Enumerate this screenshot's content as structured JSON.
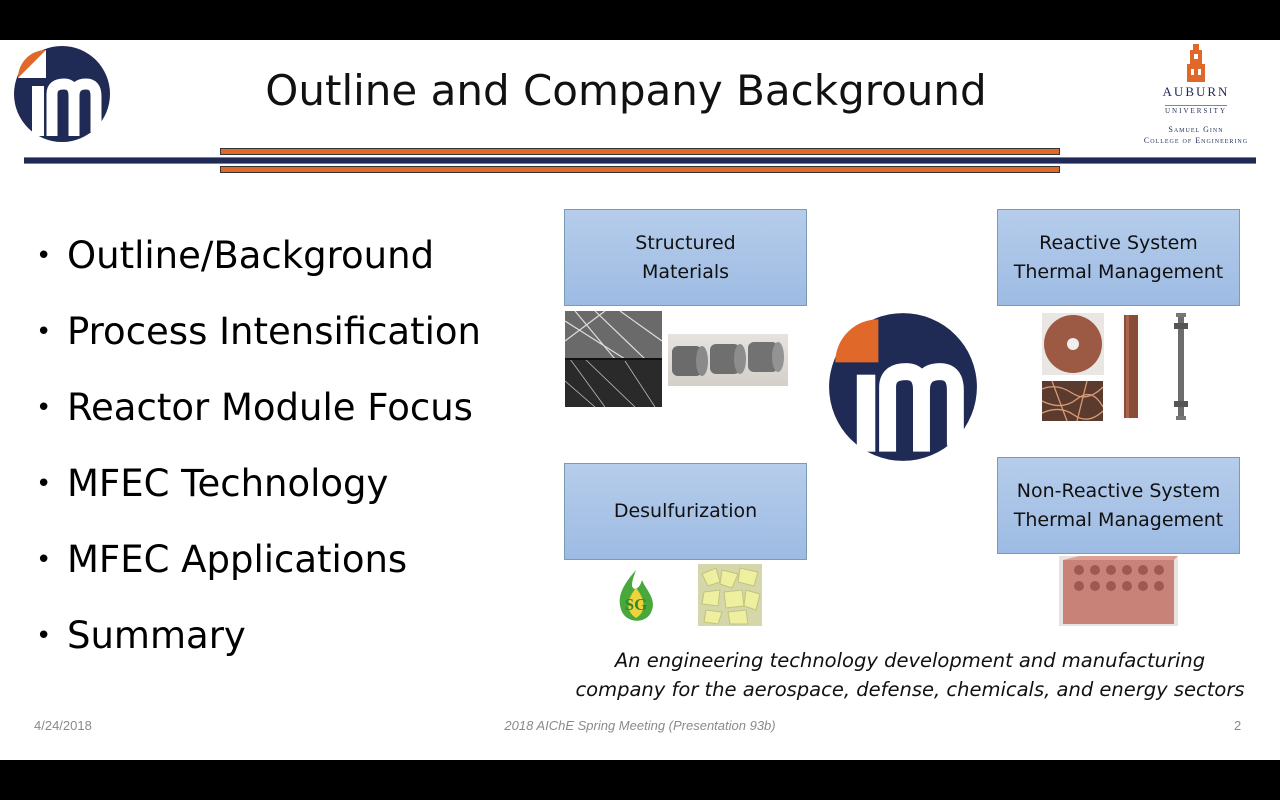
{
  "slide": {
    "title": "Outline and Company Background",
    "bullets": [
      "Outline/Background",
      "Process Intensification",
      "Reactor Module Focus",
      "MFEC Technology",
      "MFEC Applications",
      "Summary"
    ],
    "boxes": {
      "structured_materials": [
        "Structured",
        "Materials"
      ],
      "reactive_system": [
        "Reactive System",
        "Thermal Management"
      ],
      "desulfurization": "Desulfurization",
      "non_reactive_system": [
        "Non-Reactive System",
        "Thermal Management"
      ]
    },
    "tagline": [
      "An engineering technology development and manufacturing",
      "company for the aerospace, defense, chemicals, and energy sectors"
    ],
    "sg_logo_text": "SG"
  },
  "auburn_logo": {
    "name": "AUBURN",
    "university": "UNIVERSITY",
    "college_line1": "Samuel Ginn",
    "college_line2": "College of Engineering"
  },
  "footer": {
    "date": "4/24/2018",
    "meeting": "2018 AIChE Spring Meeting (Presentation 93b)",
    "page": "2"
  },
  "colors": {
    "navy": "#1f2a55",
    "orange": "#e0692a",
    "box_blue": "#a9c4e8"
  },
  "icons": [
    "im-logo",
    "auburn-tower-logo",
    "sg-logo"
  ]
}
